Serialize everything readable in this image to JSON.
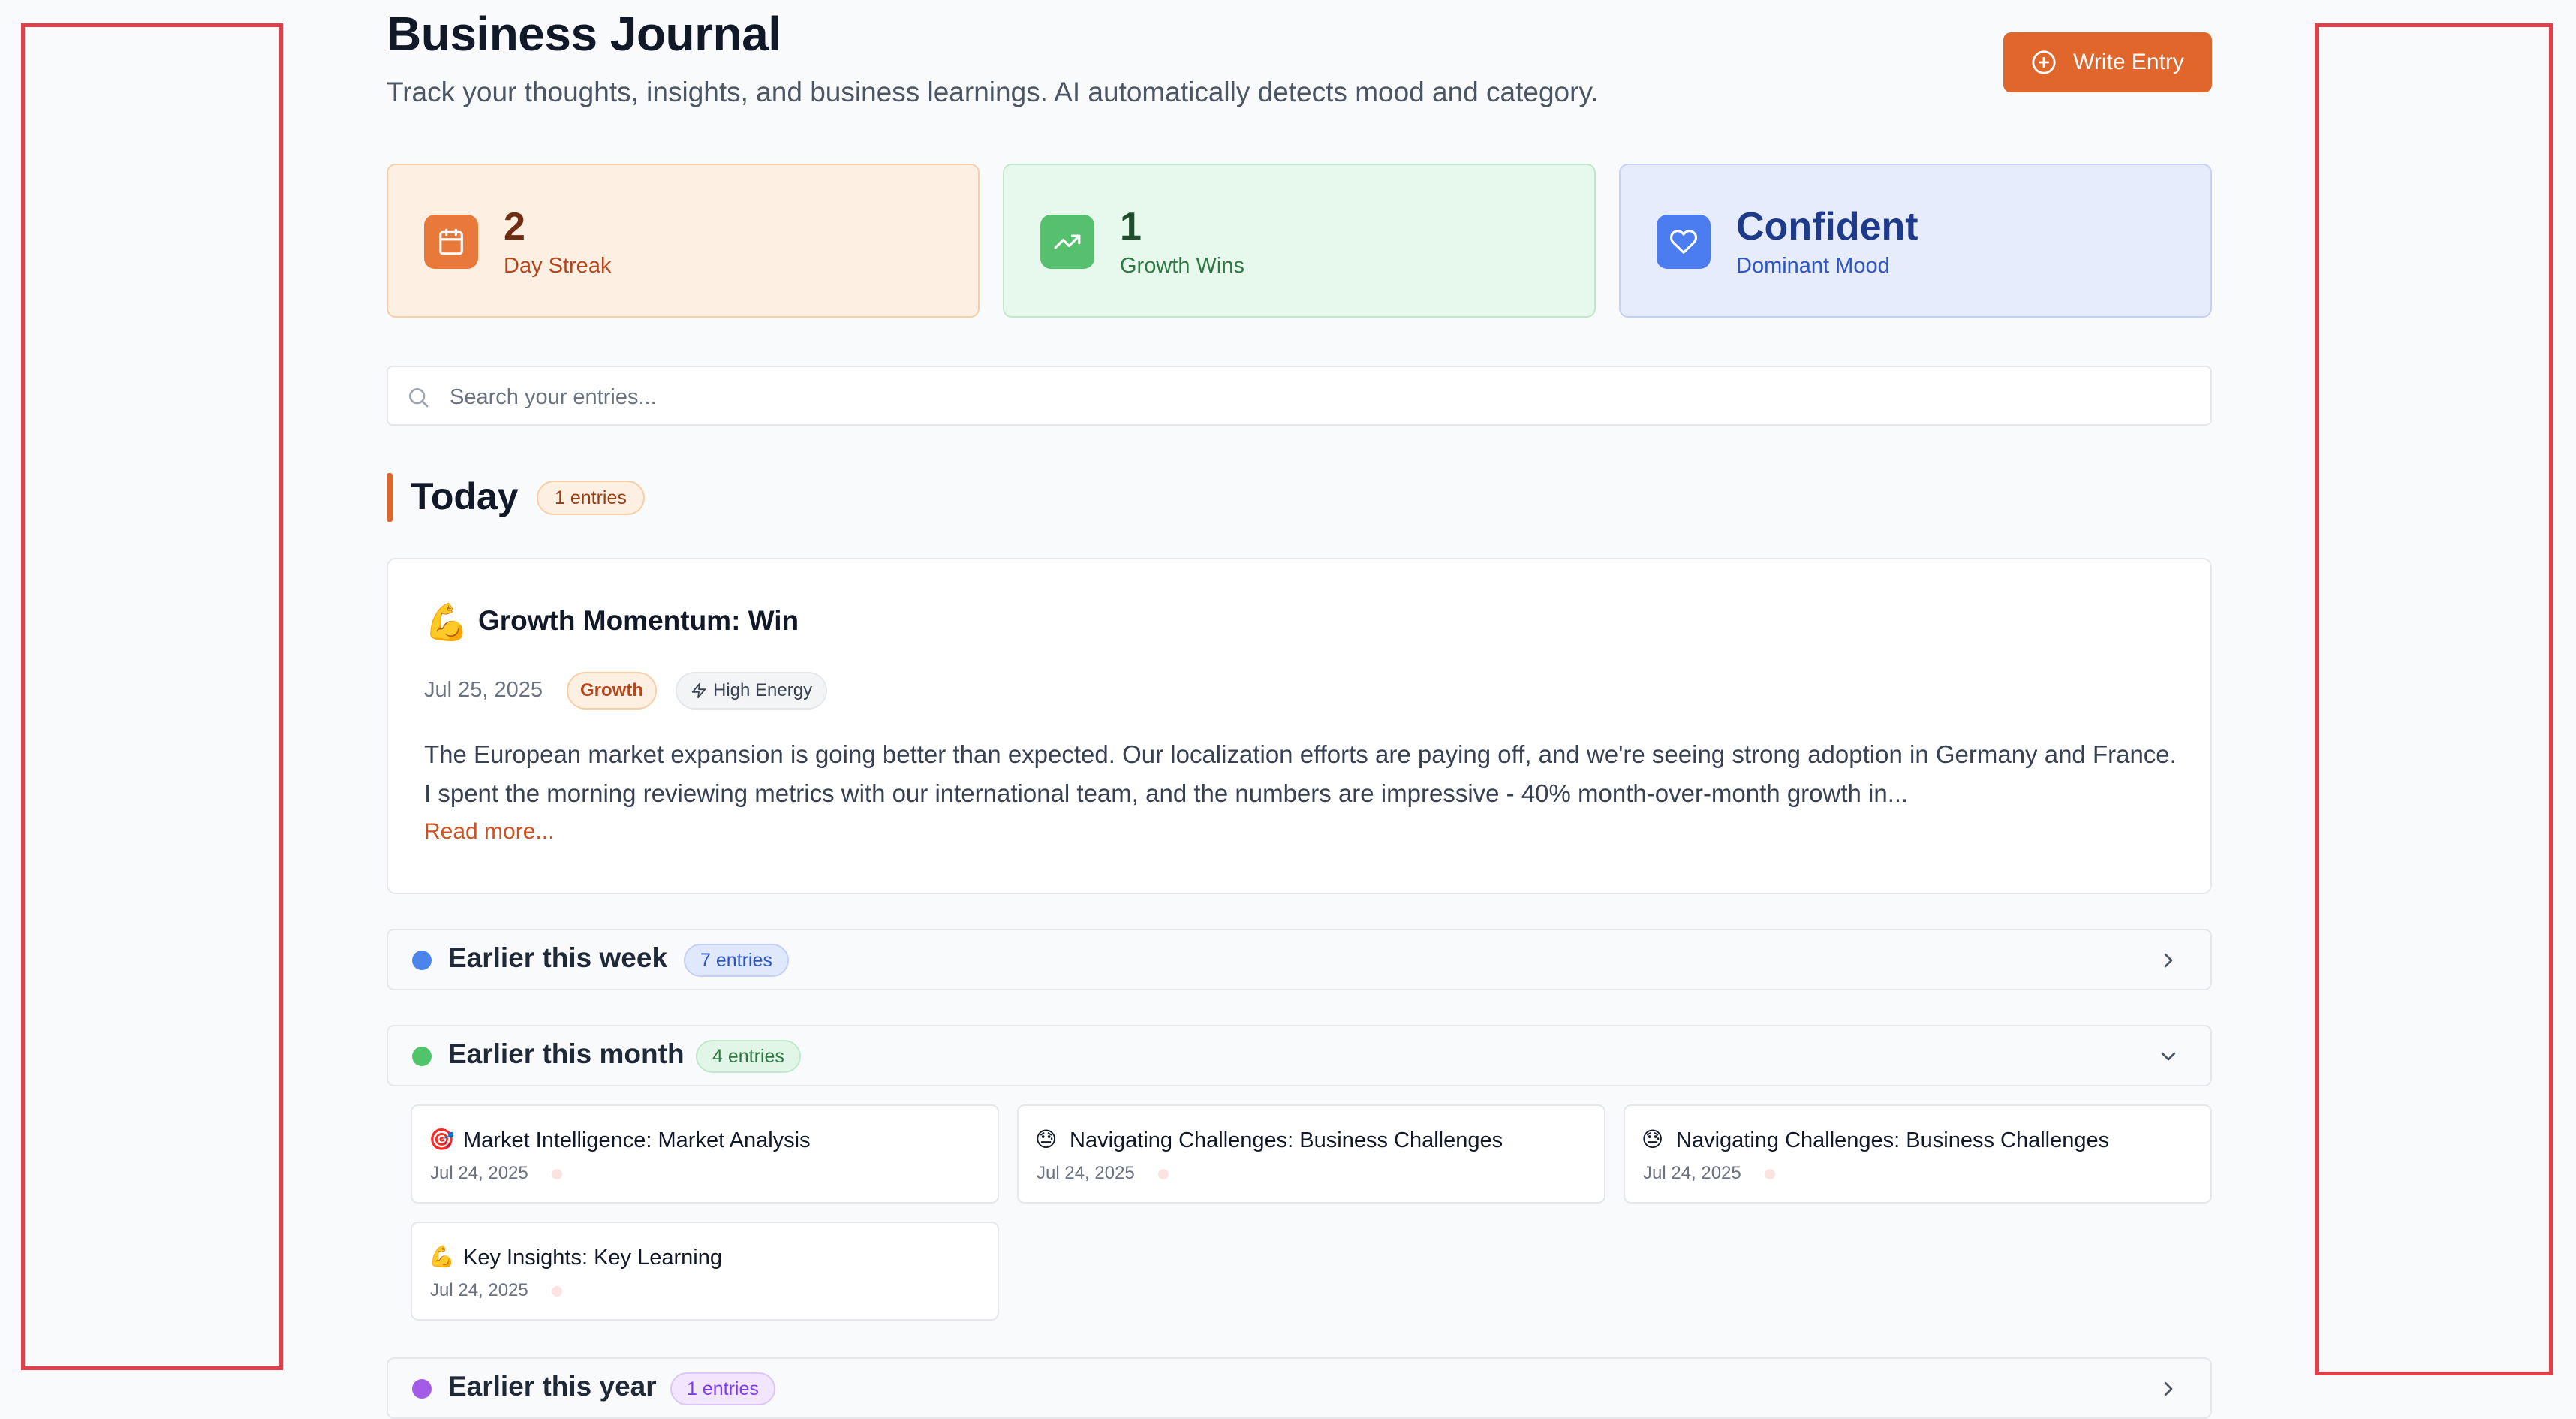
{
  "header": {
    "title": "Business Journal",
    "subtitle": "Track your thoughts, insights, and business learnings. AI automatically detects mood and category.",
    "write_button": "Write Entry"
  },
  "stats": [
    {
      "value": "2",
      "label": "Day Streak",
      "icon": "calendar-icon",
      "color": "#e8793a"
    },
    {
      "value": "1",
      "label": "Growth Wins",
      "icon": "trending-up-icon",
      "color": "#57c06e"
    },
    {
      "value": "Confident",
      "label": "Dominant Mood",
      "icon": "heart-icon",
      "color": "#4b7cf0"
    }
  ],
  "search": {
    "placeholder": "Search your entries..."
  },
  "today": {
    "title": "Today",
    "badge": "1 entries",
    "entry": {
      "emoji": "💪",
      "title": "Growth Momentum: Win",
      "date": "Jul 25, 2025",
      "category": "Growth",
      "energy": "High Energy",
      "body": "The European market expansion is going better than expected. Our localization efforts are paying off, and we're seeing strong adoption in Germany and France. I spent the morning reviewing metrics with our international team, and the numbers are impressive - 40% month-over-month growth in...",
      "read_more": "Read more..."
    }
  },
  "groups": {
    "week": {
      "title": "Earlier this week",
      "badge": "7 entries",
      "expanded": false
    },
    "month": {
      "title": "Earlier this month",
      "badge": "4 entries",
      "expanded": true,
      "entries": [
        {
          "emoji": "🎯",
          "title": "Market Intelligence: Market Analysis",
          "date": "Jul 24, 2025"
        },
        {
          "emoji": "😓",
          "title": "Navigating Challenges: Business Challenges",
          "date": "Jul 24, 2025"
        },
        {
          "emoji": "😓",
          "title": "Navigating Challenges: Business Challenges",
          "date": "Jul 24, 2025"
        },
        {
          "emoji": "💪",
          "title": "Key Insights: Key Learning",
          "date": "Jul 24, 2025"
        }
      ]
    },
    "year": {
      "title": "Earlier this year",
      "badge": "1 entries",
      "expanded": false
    }
  },
  "colors": {
    "accent": "#e0662b",
    "annotation_box": "#e0404a"
  }
}
